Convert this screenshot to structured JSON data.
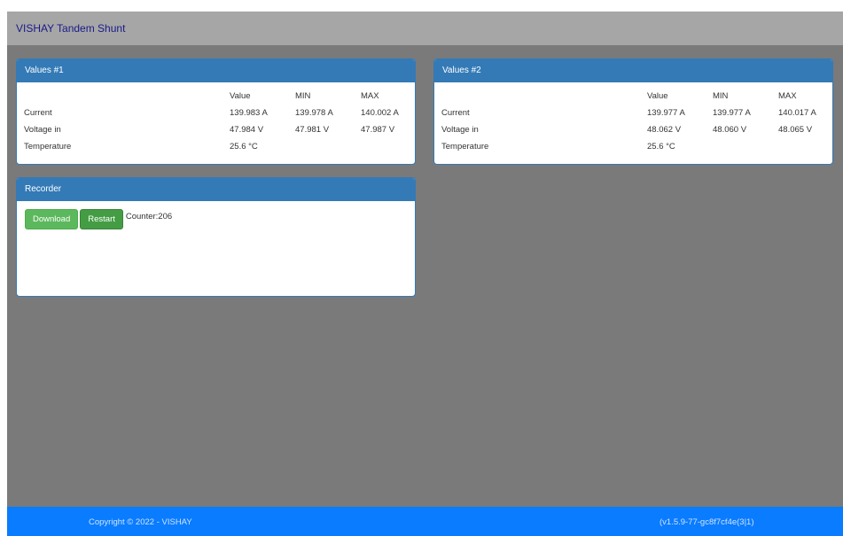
{
  "navbar": {
    "brand": "VISHAY Tandem Shunt"
  },
  "panels": {
    "values1": {
      "title": "Values #1",
      "headers": [
        "Value",
        "MIN",
        "MAX"
      ],
      "rows": [
        {
          "label": "Current",
          "value": "139.983 A",
          "min": "139.978 A",
          "max": "140.002 A"
        },
        {
          "label": "Voltage in",
          "value": "47.984 V",
          "min": "47.981 V",
          "max": "47.987 V"
        },
        {
          "label": "Temperature",
          "value": "25.6 °C",
          "min": "",
          "max": ""
        }
      ]
    },
    "values2": {
      "title": "Values #2",
      "headers": [
        "Value",
        "MIN",
        "MAX"
      ],
      "rows": [
        {
          "label": "Current",
          "value": "139.977 A",
          "min": "139.977 A",
          "max": "140.017 A"
        },
        {
          "label": "Voltage in",
          "value": "48.062 V",
          "min": "48.060 V",
          "max": "48.065 V"
        },
        {
          "label": "Temperature",
          "value": "25.6 °C",
          "min": "",
          "max": ""
        }
      ]
    },
    "recorder": {
      "title": "Recorder",
      "download_label": "Download",
      "restart_label": "Restart",
      "counter_text": "Counter:206"
    }
  },
  "footer": {
    "copyright": "Copyright © 2022 - VISHAY",
    "version": "(v1.5.9-77-gc8f7cf4e(3|1)"
  },
  "colors": {
    "panel_heading": "#337ab7",
    "background": "#7a7a7a",
    "navbar": "#a6a6a6",
    "footer": "#0a7cff",
    "button_green": "#5cb85c"
  }
}
